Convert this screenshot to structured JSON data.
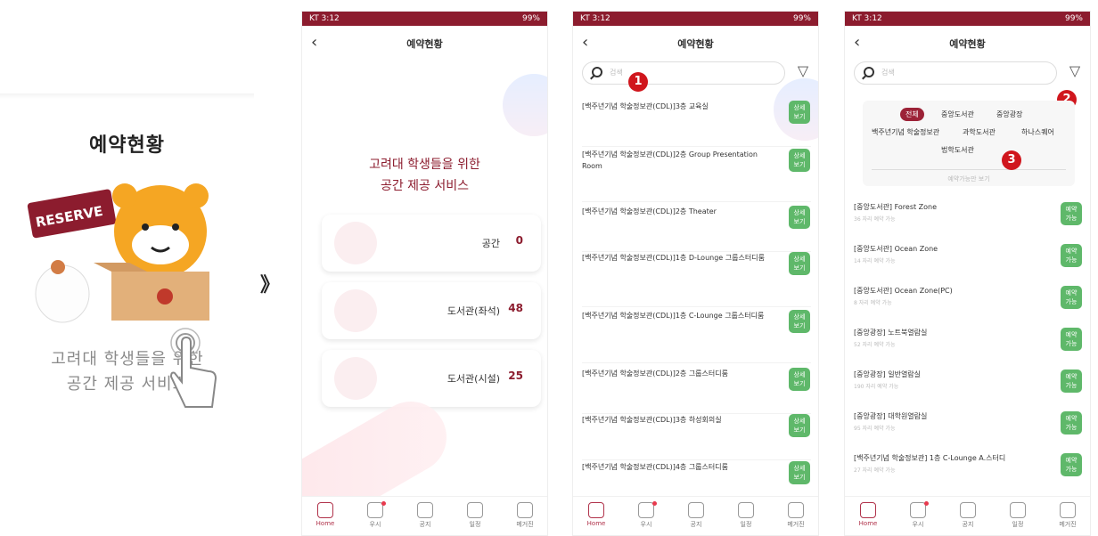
{
  "intro": {
    "title": "예약현황",
    "reserve_stamp": "RESERVE",
    "slogan_line1": "고려대 학생들을 위한",
    "slogan_line2": "공간 제공 서비스"
  },
  "separator": "》",
  "status_left": "KT 3:12",
  "status_right": "99%",
  "app_title": "예약현황",
  "search_placeholder": "검색",
  "nav": [
    "Home",
    "우시",
    "공지",
    "일정",
    "메거진"
  ],
  "phone2": {
    "slogan_line1": "고려대 학생들을 위한",
    "slogan_line2": "공간 제공 서비스",
    "cards": [
      {
        "label": "공간",
        "count": "0"
      },
      {
        "label": "도서관(좌석)",
        "count": "48"
      },
      {
        "label": "도서관(시설)",
        "count": "25"
      }
    ]
  },
  "phone3": {
    "badge": "1",
    "button_label_1": "상세",
    "button_label_2": "보기",
    "rows": [
      "[백주년기념 학술정보관(CDL)]3층 교육실",
      "[백주년기념 학술정보관(CDL)]2층 Group Presentation Room",
      "[백주년기념 학술정보관(CDL)]2층 Theater",
      "[백주년기념 학술정보관(CDL)]1층 D-Lounge 그룹스터디룸",
      "[백주년기념 학술정보관(CDL)]1층 C-Lounge 그룹스터디룸",
      "[백주년기념 학술정보관(CDL)]2층 그룹스터디룸",
      "[백주년기념 학술정보관(CDL)]3층 하성회의실",
      "[백주년기념 학술정보관(CDL)]4층 그룹스터디룸"
    ]
  },
  "phone4": {
    "badge2": "2",
    "badge3": "3",
    "chips": [
      "전체",
      "중앙도서관",
      "중앙광장",
      "백주년기념 학술정보관",
      "과학도서관",
      "하나스퀘어",
      "법학도서관"
    ],
    "avail_label": "예약가능만 보기",
    "button_label_1": "예약",
    "button_label_2": "가능",
    "rows": [
      {
        "name": "[중앙도서관] Forest Zone",
        "sub": "36 자리 예약 가능"
      },
      {
        "name": "[중앙도서관] Ocean Zone",
        "sub": "14 자리 예약 가능"
      },
      {
        "name": "[중앙도서관] Ocean Zone(PC)",
        "sub": "8 자리 예약 가능"
      },
      {
        "name": "[중앙광장] 노트북열람실",
        "sub": "52 자리 예약 가능"
      },
      {
        "name": "[중앙광장] 일반열람실",
        "sub": "190 자리 예약 가능"
      },
      {
        "name": "[중앙광장] 대학원열람실",
        "sub": "95 자리 예약 가능"
      },
      {
        "name": "[백주년기념 학술정보관] 1층 C-Lounge A.스터디",
        "sub": "27 자리 예약 가능"
      }
    ]
  }
}
